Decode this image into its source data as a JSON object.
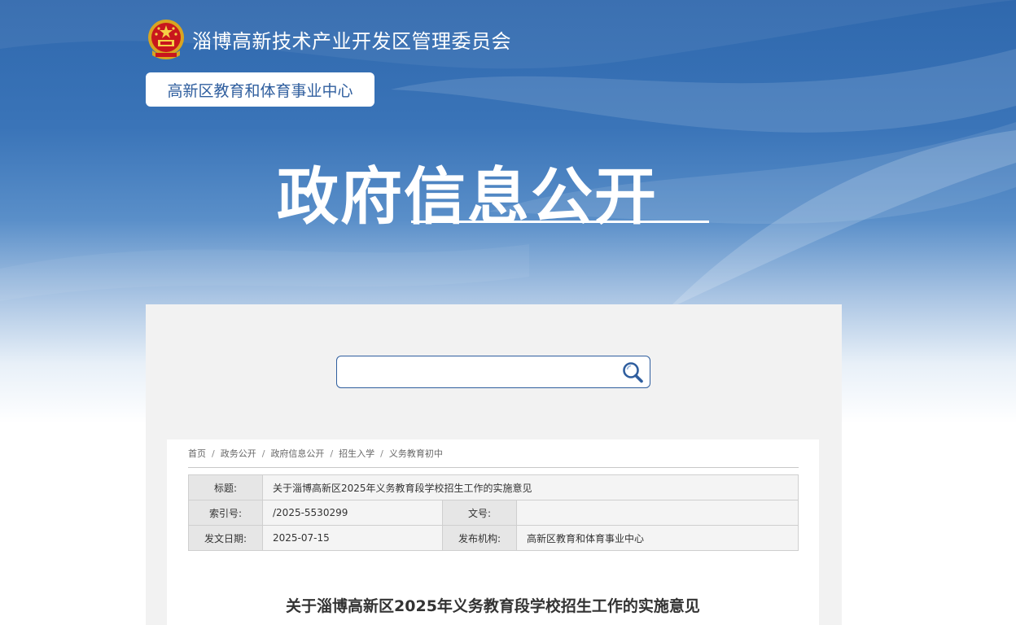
{
  "header": {
    "site_name": "淄博高新技术产业开发区管理委员会",
    "department": "高新区教育和体育事业中心",
    "section_title": "政府信息公开",
    "emblem_icon": "national-emblem-icon"
  },
  "search": {
    "value": "",
    "icon": "magnifier-icon"
  },
  "breadcrumb": [
    "首页",
    "政务公开",
    "政府信息公开",
    "招生入学",
    "义务教育初中"
  ],
  "meta": {
    "title_label": "标题:",
    "title_value": "关于淄博高新区2025年义务教育段学校招生工作的实施意见",
    "index_label": "索引号:",
    "index_value": "/2025-5530299",
    "docno_label": "文号:",
    "docno_value": "",
    "date_label": "发文日期:",
    "date_value": "2025-07-15",
    "org_label": "发布机构:",
    "org_value": "高新区教育和体育事业中心"
  },
  "document": {
    "title": "关于淄博高新区2025年义务教育段学校招生工作的实施意见"
  },
  "colors": {
    "brand_blue": "#2f68ad",
    "panel_gray": "#f2f2f2"
  }
}
